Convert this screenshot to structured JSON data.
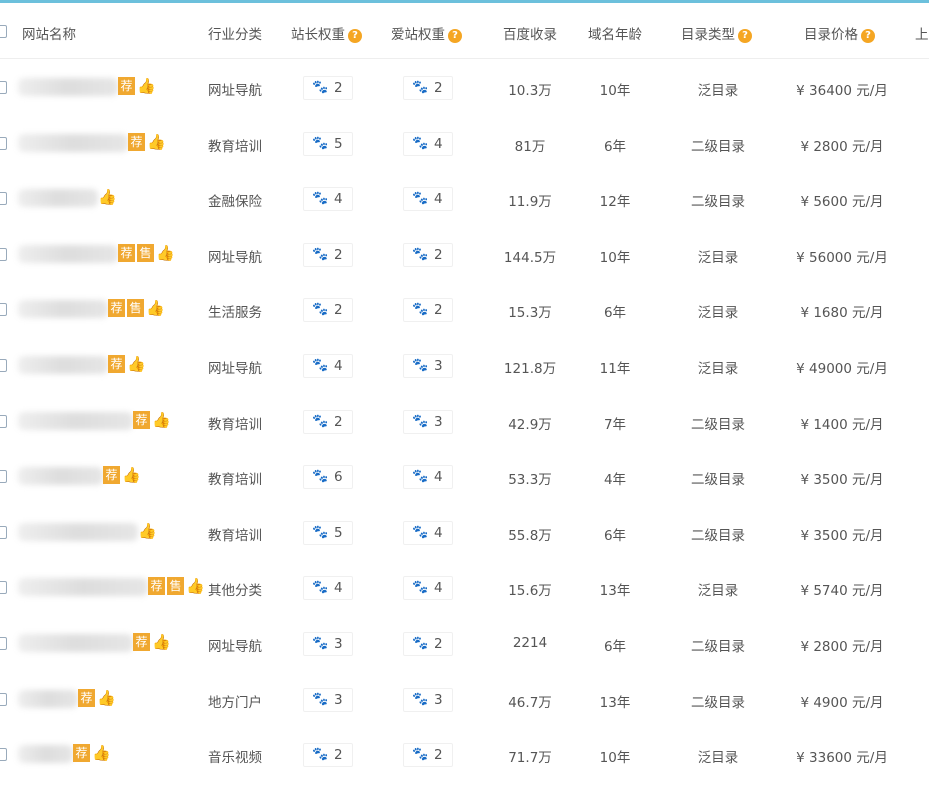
{
  "header": {
    "name": "网站名称",
    "industry": "行业分类",
    "zz_weight": "站长权重",
    "az_weight": "爱站权重",
    "baidu": "百度收录",
    "age": "域名年龄",
    "dir_type": "目录类型",
    "dir_price": "目录价格",
    "last": "上",
    "help": "?"
  },
  "badges": {
    "recommend": "荐",
    "sale": "售"
  },
  "rows": [
    {
      "industry": "网址导航",
      "zz": "2",
      "az": "2",
      "baidu": "10.3万",
      "age": "10年",
      "type": "泛目录",
      "price": "¥ 36400 元/月",
      "tags": [
        "荐"
      ]
    },
    {
      "industry": "教育培训",
      "zz": "5",
      "az": "4",
      "baidu": "81万",
      "age": "6年",
      "type": "二级目录",
      "price": "¥ 2800 元/月",
      "tags": [
        "荐"
      ]
    },
    {
      "industry": "金融保险",
      "zz": "4",
      "az": "4",
      "baidu": "11.9万",
      "age": "12年",
      "type": "二级目录",
      "price": "¥ 5600 元/月",
      "tags": []
    },
    {
      "industry": "网址导航",
      "zz": "2",
      "az": "2",
      "baidu": "144.5万",
      "age": "10年",
      "type": "泛目录",
      "price": "¥ 56000 元/月",
      "tags": [
        "荐",
        "售"
      ]
    },
    {
      "industry": "生活服务",
      "zz": "2",
      "az": "2",
      "baidu": "15.3万",
      "age": "6年",
      "type": "泛目录",
      "price": "¥ 1680 元/月",
      "tags": [
        "荐",
        "售"
      ]
    },
    {
      "industry": "网址导航",
      "zz": "4",
      "az": "3",
      "baidu": "121.8万",
      "age": "11年",
      "type": "泛目录",
      "price": "¥ 49000 元/月",
      "tags": [
        "荐"
      ]
    },
    {
      "industry": "教育培训",
      "zz": "2",
      "az": "3",
      "baidu": "42.9万",
      "age": "7年",
      "type": "二级目录",
      "price": "¥ 1400 元/月",
      "tags": [
        "荐"
      ]
    },
    {
      "industry": "教育培训",
      "zz": "6",
      "az": "4",
      "baidu": "53.3万",
      "age": "4年",
      "type": "二级目录",
      "price": "¥ 3500 元/月",
      "tags": [
        "荐"
      ]
    },
    {
      "industry": "教育培训",
      "zz": "5",
      "az": "4",
      "baidu": "55.8万",
      "age": "6年",
      "type": "二级目录",
      "price": "¥ 3500 元/月",
      "tags": []
    },
    {
      "industry": "其他分类",
      "zz": "4",
      "az": "4",
      "baidu": "15.6万",
      "age": "13年",
      "type": "泛目录",
      "price": "¥ 5740 元/月",
      "tags": [
        "荐",
        "售"
      ]
    },
    {
      "industry": "网址导航",
      "zz": "3",
      "az": "2",
      "baidu": "2214",
      "age": "6年",
      "type": "二级目录",
      "price": "¥ 2800 元/月",
      "tags": [
        "荐"
      ]
    },
    {
      "industry": "地方门户",
      "zz": "3",
      "az": "3",
      "baidu": "46.7万",
      "age": "13年",
      "type": "二级目录",
      "price": "¥ 4900 元/月",
      "tags": [
        "荐"
      ]
    },
    {
      "industry": "音乐视频",
      "zz": "2",
      "az": "2",
      "baidu": "71.7万",
      "age": "10年",
      "type": "泛目录",
      "price": "¥ 33600 元/月",
      "tags": [
        "荐"
      ]
    }
  ],
  "colors": {
    "zz_paw": "#3a2ea8",
    "az_paw": "#4a90d9",
    "badge": "#f0a830",
    "thumb": "#e84545"
  }
}
